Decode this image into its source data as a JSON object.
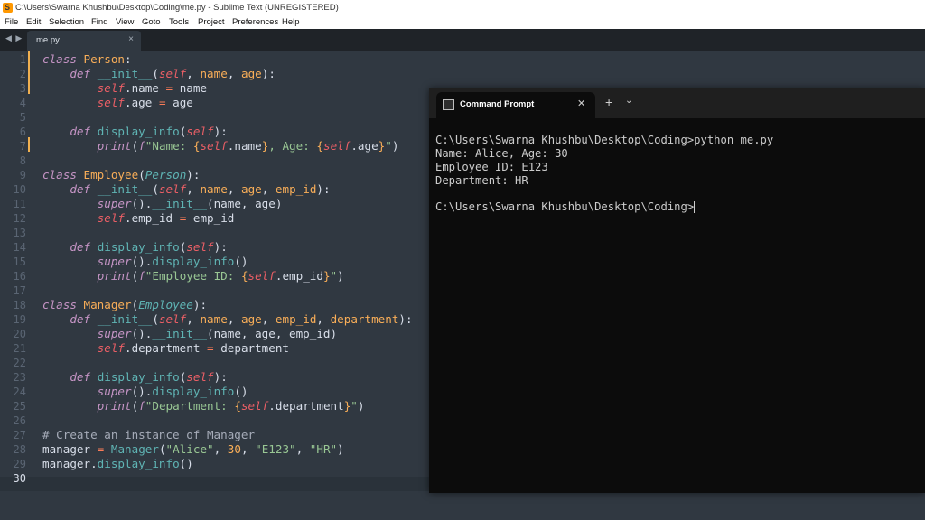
{
  "window": {
    "title": "C:\\Users\\Swarna Khushbu\\Desktop\\Coding\\me.py - Sublime Text (UNREGISTERED)"
  },
  "menu": [
    "File",
    "Edit",
    "Selection",
    "Find",
    "View",
    "Goto",
    "Tools",
    "Project",
    "Preferences",
    "Help"
  ],
  "tab": {
    "name": "me.py",
    "close": "×"
  },
  "nav": {
    "arrows": "◀ ▶"
  },
  "line_numbers": [
    "1",
    "2",
    "3",
    "4",
    "5",
    "6",
    "7",
    "8",
    "9",
    "10",
    "11",
    "12",
    "13",
    "14",
    "15",
    "16",
    "17",
    "18",
    "19",
    "20",
    "21",
    "22",
    "23",
    "24",
    "25",
    "26",
    "27",
    "28",
    "29",
    "30"
  ],
  "code_lines": [
    "class Person:",
    "    def __init__(self, name, age):",
    "        self.name = name",
    "        self.age = age",
    "",
    "    def display_info(self):",
    "        print(f\"Name: {self.name}, Age: {self.age}\")",
    "",
    "class Employee(Person):",
    "    def __init__(self, name, age, emp_id):",
    "        super().__init__(name, age)",
    "        self.emp_id = emp_id",
    "",
    "    def display_info(self):",
    "        super().display_info()",
    "        print(f\"Employee ID: {self.emp_id}\")",
    "",
    "class Manager(Employee):",
    "    def __init__(self, name, age, emp_id, department):",
    "        super().__init__(name, age, emp_id)",
    "        self.department = department",
    "",
    "    def display_info(self):",
    "        super().display_info()",
    "        print(f\"Department: {self.department}\")",
    "",
    "# Create an instance of Manager",
    "manager = Manager(\"Alice\", 30, \"E123\", \"HR\")",
    "manager.display_info()",
    ""
  ],
  "cmd": {
    "tab_title": "Command Prompt",
    "close": "✕",
    "plus": "+",
    "dropdown": "⌄",
    "lines": [
      "C:\\Users\\Swarna Khushbu\\Desktop\\Coding>python me.py",
      "Name: Alice, Age: 30",
      "Employee ID: E123",
      "Department: HR",
      "",
      "C:\\Users\\Swarna Khushbu\\Desktop\\Coding>"
    ]
  }
}
